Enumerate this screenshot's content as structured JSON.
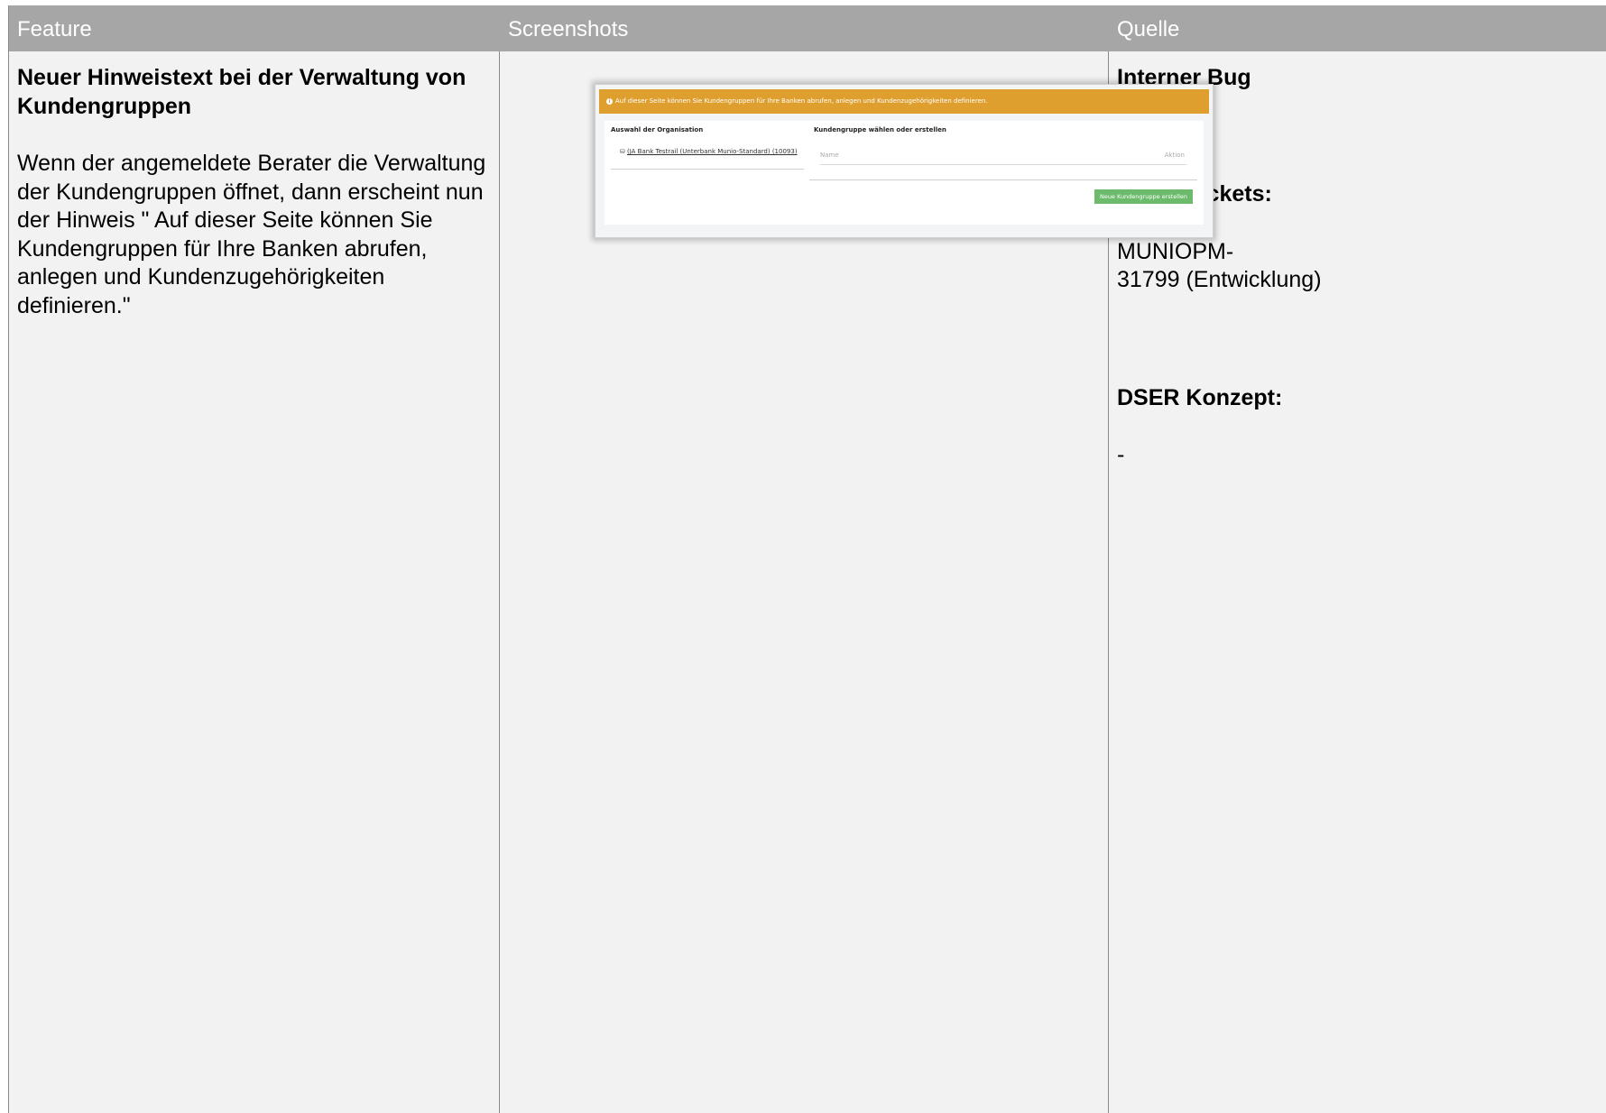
{
  "header": {
    "col_feature": "Feature",
    "col_screenshots": "Screenshots",
    "col_quelle": "Quelle"
  },
  "feature": {
    "title": "Neuer Hinweistext bei der Verwaltung von Kundengruppen",
    "description": "Wenn der angemeldete Berater die Verwaltung der Kundengruppen öffnet, dann erscheint nun der Hinweis \" Auf dieser Seite können Sie Kundengruppen für Ihre Banken abrufen, anlegen und Kundenzugehörigkeiten definieren.\""
  },
  "screenshot": {
    "banner_text": "Auf dieser Seite können Sie Kundengruppen für Ihre Banken abrufen, anlegen und Kundenzugehörigkeiten definieren.",
    "org_label": "Auswahl der Organisation",
    "org_item": "(JA Bank Testrail (Unterbank Munio-Standard) (10093)",
    "group_label": "Kundengruppe wählen oder erstellen",
    "name_placeholder": "Name",
    "action_label": "Aktion",
    "create_button": "Neue Kundengruppe erstellen"
  },
  "quelle": {
    "source": "Interner Bug",
    "tickets_label": "DSER-Tickets:",
    "ticket_line1": "MUNIOPM-",
    "ticket_line2": "31799 (Entwicklung)",
    "concept_label": "DSER Konzept:",
    "concept_value": "-"
  }
}
